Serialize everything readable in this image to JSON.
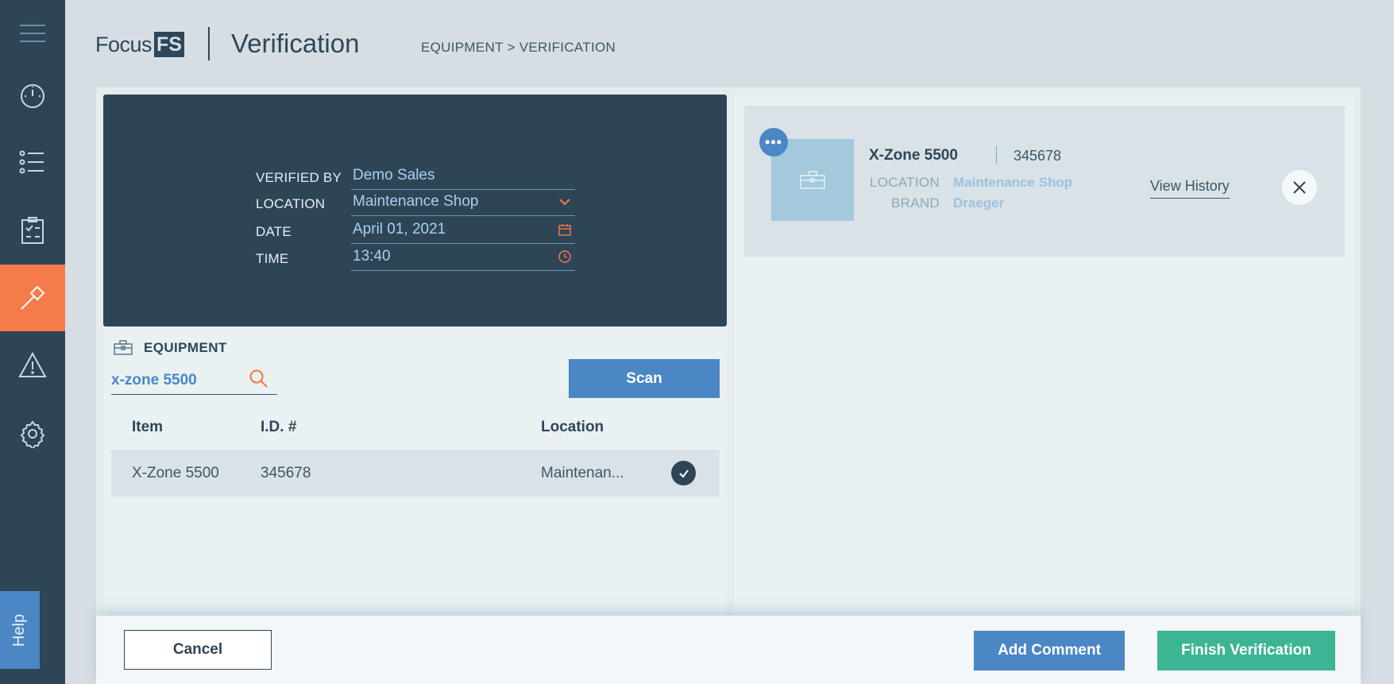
{
  "app": {
    "logo_text": "Focus",
    "logo_box": "FS",
    "page_title": "Verification",
    "breadcrumb": "EQUIPMENT > VERIFICATION"
  },
  "sidebar": {
    "items": [
      {
        "icon": "menu-icon"
      },
      {
        "icon": "dashboard-gauge-icon"
      },
      {
        "icon": "list-icon"
      },
      {
        "icon": "checklist-clipboard-icon"
      },
      {
        "icon": "hammer-icon",
        "active": true
      },
      {
        "icon": "warning-icon"
      },
      {
        "icon": "gear-icon"
      }
    ],
    "help_label": "Help"
  },
  "form": {
    "verified_by_label": "VERIFIED BY",
    "verified_by_value": "Demo Sales",
    "location_label": "LOCATION",
    "location_value": "Maintenance Shop",
    "date_label": "DATE",
    "date_value": "April 01, 2021",
    "time_label": "TIME",
    "time_value": "13:40"
  },
  "equipment": {
    "heading": "EQUIPMENT",
    "search_value": "x-zone 5500",
    "scan_label": "Scan",
    "columns": [
      "Item",
      "I.D. #",
      "Location"
    ],
    "rows": [
      {
        "item": "X-Zone 5500",
        "id": "345678",
        "location": "Maintenan..."
      }
    ]
  },
  "selected": {
    "name": "X-Zone 5500",
    "id": "345678",
    "location_label": "LOCATION",
    "location_value": "Maintenance Shop",
    "brand_label": "BRAND",
    "brand_value": "Draeger",
    "view_history_label": "View History"
  },
  "footer": {
    "cancel_label": "Cancel",
    "add_comment_label": "Add Comment",
    "finish_label": "Finish Verification"
  },
  "colors": {
    "sidebar": "#2e4556",
    "accent_orange": "#f57c4a",
    "primary_blue": "#4b86c5",
    "success_green": "#3cb595"
  }
}
